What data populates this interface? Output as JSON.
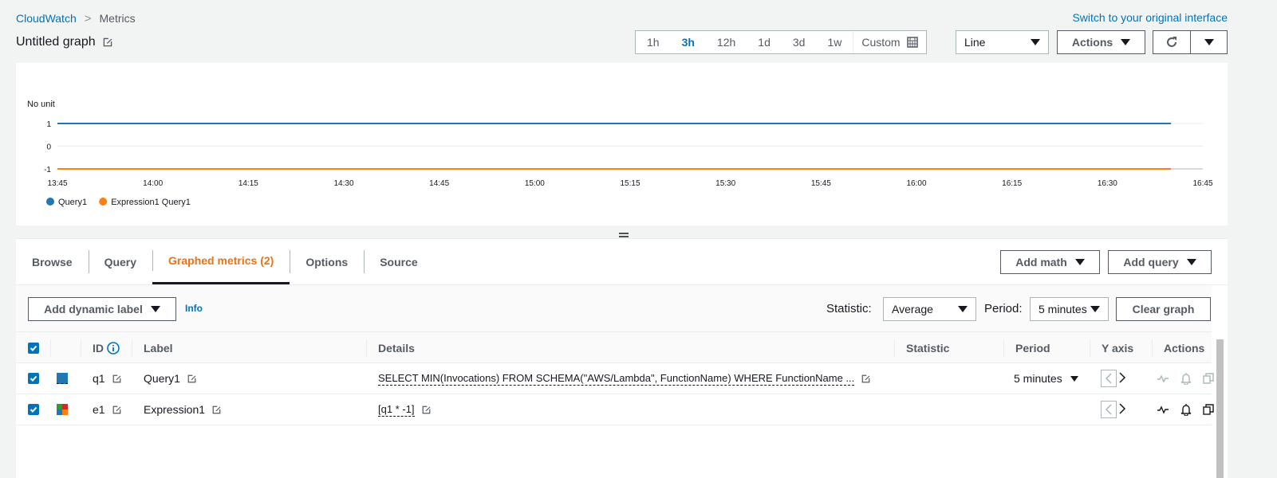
{
  "breadcrumb": {
    "root": "CloudWatch",
    "separator": ">",
    "current": "Metrics"
  },
  "header": {
    "switch_link": "Switch to your original interface",
    "title": "Untitled graph"
  },
  "time_range": {
    "options": [
      "1h",
      "3h",
      "12h",
      "1d",
      "3d",
      "1w"
    ],
    "selected": "3h",
    "custom_label": "Custom"
  },
  "chart_type_select": {
    "value": "Line"
  },
  "actions_button": {
    "label": "Actions"
  },
  "chart_data": {
    "type": "line",
    "unit_label": "No unit",
    "y_ticks": [
      "1",
      "0",
      "-1"
    ],
    "ylim": [
      -1,
      1
    ],
    "x_ticks": [
      "13:45",
      "14:00",
      "14:15",
      "14:30",
      "14:45",
      "15:00",
      "15:15",
      "15:30",
      "15:45",
      "16:00",
      "16:15",
      "16:30",
      "16:45"
    ],
    "series": [
      {
        "name": "Query1",
        "color": "#1f77b4",
        "value": 1,
        "x_start": "13:45",
        "x_end": "16:40"
      },
      {
        "name": "Expression1 Query1",
        "color": "#ff7f0e",
        "value": -1,
        "x_start": "13:45",
        "x_end": "16:40"
      }
    ]
  },
  "tabs": [
    {
      "label": "Browse"
    },
    {
      "label": "Query"
    },
    {
      "label": "Graphed metrics (2)",
      "active": true
    },
    {
      "label": "Options"
    },
    {
      "label": "Source"
    }
  ],
  "tab_actions": {
    "add_math": "Add math",
    "add_query": "Add query"
  },
  "toolbar": {
    "dynamic_label": "Add dynamic label",
    "info": "Info",
    "statistic_label": "Statistic:",
    "statistic_value": "Average",
    "period_label": "Period:",
    "period_value": "5 minutes",
    "clear_graph": "Clear graph"
  },
  "table": {
    "headers": {
      "id": "ID",
      "label": "Label",
      "details": "Details",
      "statistic": "Statistic",
      "period": "Period",
      "yaxis": "Y axis",
      "actions": "Actions"
    },
    "rows": [
      {
        "id": "q1",
        "label": "Query1",
        "details": "SELECT MIN(Invocations) FROM SCHEMA(\"AWS/Lambda\", FunctionName) WHERE FunctionName ...",
        "statistic": "",
        "period": "5 minutes",
        "color": "#1f77b4"
      },
      {
        "id": "e1",
        "label": "Expression1",
        "details": "[q1 * -1]",
        "statistic": "",
        "period": "",
        "color": "multi"
      }
    ]
  }
}
